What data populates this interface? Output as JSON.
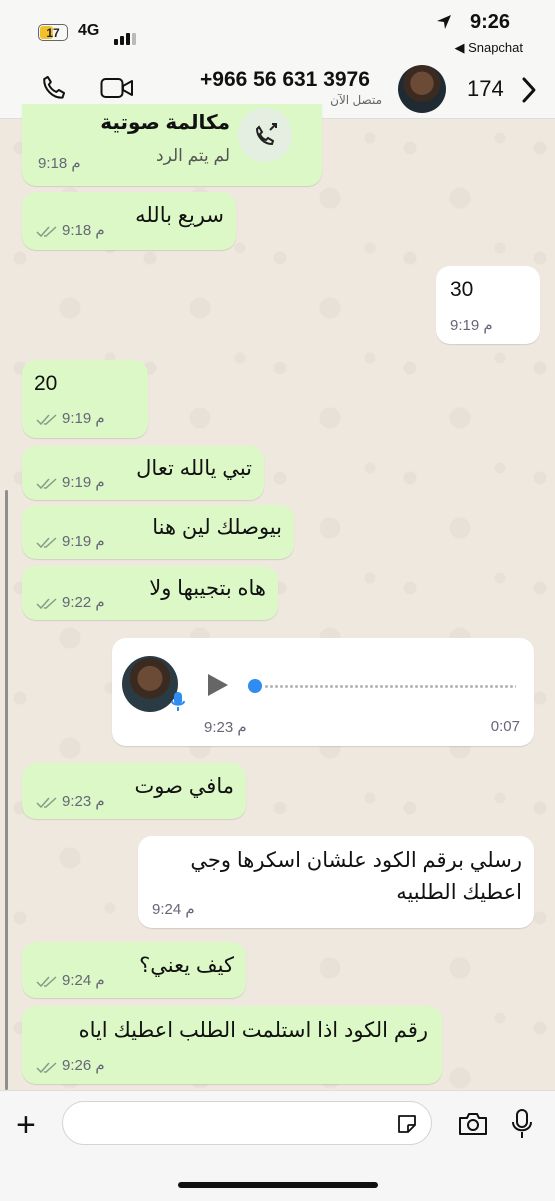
{
  "status_bar": {
    "battery": "17",
    "network": "4G",
    "time": "9:26",
    "back_app": "Snapchat"
  },
  "header": {
    "phone": "+966 56 631 3976",
    "presence": "متصل الآن",
    "unread_count": "174"
  },
  "messages": [
    {
      "kind": "call",
      "title": "مكالمة صوتية",
      "subtitle": "لم يتم الرد",
      "time": "9:18 م"
    },
    {
      "kind": "in",
      "text": "سريع بالله",
      "time": "9:18 م"
    },
    {
      "kind": "out",
      "text": "30",
      "time": "9:19 م"
    },
    {
      "kind": "in",
      "text": "20",
      "time": "9:19 م"
    },
    {
      "kind": "in",
      "text": "تبي يالله تعال",
      "time": "9:19 م"
    },
    {
      "kind": "in",
      "text": "بيوصلك لين هنا",
      "time": "9:19 م"
    },
    {
      "kind": "in",
      "text": "هاه بتجيبها ولا",
      "time": "9:22 م"
    },
    {
      "kind": "voice",
      "duration": "0:07",
      "time": "9:23 م"
    },
    {
      "kind": "in",
      "text": "مافي صوت",
      "time": "9:23 م"
    },
    {
      "kind": "out",
      "text_line1": "رسلي برقم الكود علشان اسكرها وجي",
      "text_line2": "اعطيك الطلبيه",
      "time": "9:24 م"
    },
    {
      "kind": "in",
      "text": "كيف يعني؟",
      "time": "9:24 م"
    },
    {
      "kind": "in",
      "text": "رقم الكود اذا استلمت الطلب اعطيك اياه",
      "time": "9:26 م"
    }
  ],
  "colors": {
    "incoming_bubble": "#dcf8c6",
    "outgoing_bubble": "#ffffff",
    "voice_accent": "#2f8cf2",
    "tick_color": "#8a9a8a"
  },
  "icons": [
    "phone-icon",
    "video-icon",
    "chevron-right-icon",
    "location-arrow-icon",
    "plus-icon",
    "sticker-icon",
    "camera-icon",
    "mic-icon",
    "play-icon",
    "call-icon"
  ]
}
